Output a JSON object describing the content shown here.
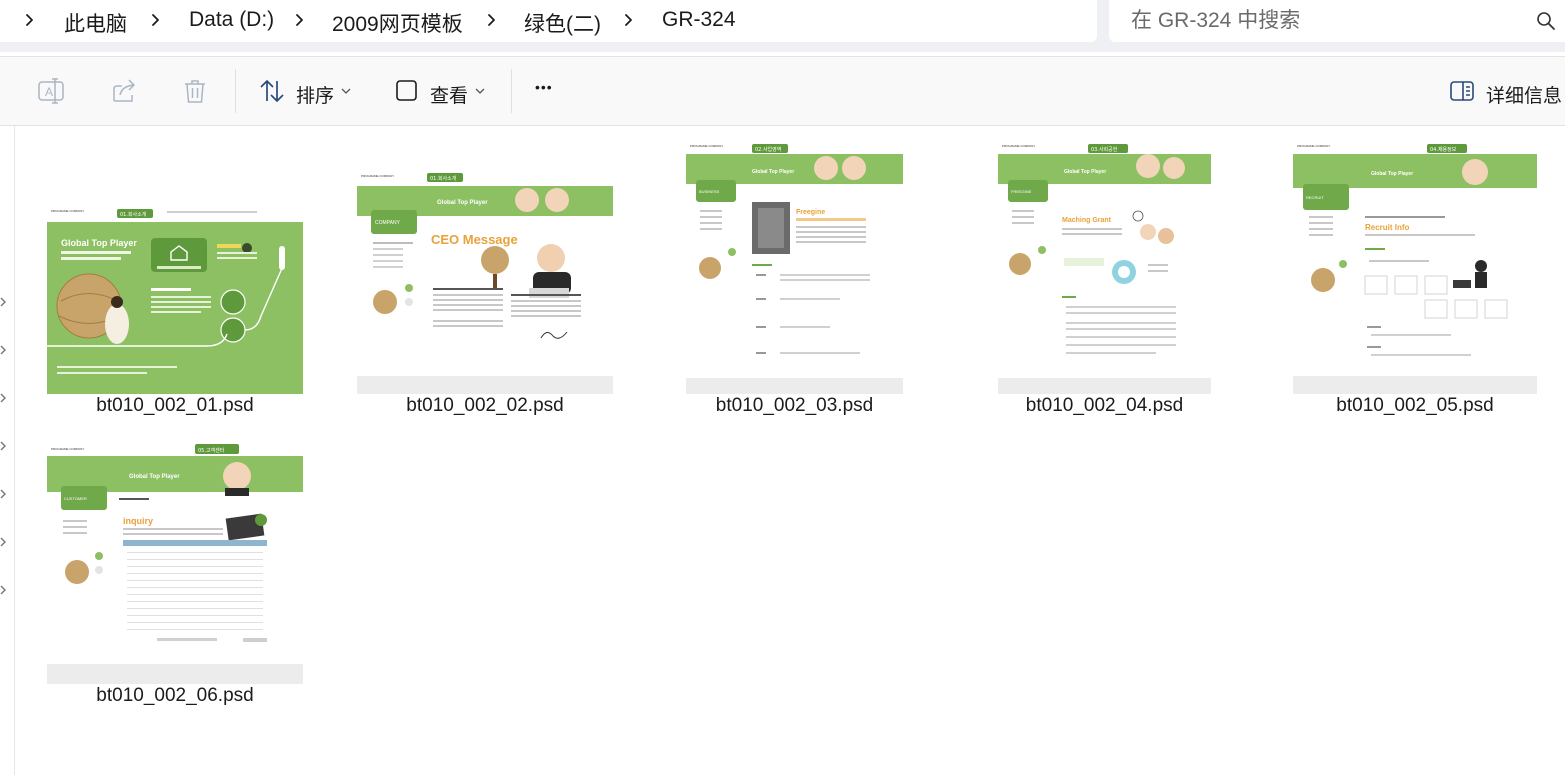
{
  "address_bar": {
    "path": [
      "此电脑",
      "Data (D:)",
      "2009网页模板",
      "绿色(二)",
      "GR-324"
    ]
  },
  "search": {
    "placeholder": "在 GR-324 中搜索"
  },
  "toolbar": {
    "sort_label": "排序",
    "view_label": "查看",
    "more_label": "•••",
    "details_label": "详细信息"
  },
  "files": [
    {
      "name": "bt010_002_01.psd",
      "thumb": {
        "heading": "Global Top Player",
        "section": "01.회사소개",
        "variant": "main"
      }
    },
    {
      "name": "bt010_002_02.psd",
      "thumb": {
        "heading": "Global Top Player",
        "section": "01.회사소개",
        "side_title": "COMPANY",
        "headline": "CEO Message",
        "variant": "ceo"
      }
    },
    {
      "name": "bt010_002_03.psd",
      "thumb": {
        "heading": "Global Top Player",
        "section": "02.사업영역",
        "side_title": "BUSINESS",
        "headline": "Freegine",
        "variant": "business"
      }
    },
    {
      "name": "bt010_002_04.psd",
      "thumb": {
        "heading": "Global Top Player",
        "section": "03.사회공헌",
        "side_title": "FREEGINE",
        "headline": "Maching Grant",
        "variant": "social"
      }
    },
    {
      "name": "bt010_002_05.psd",
      "thumb": {
        "heading": "Global Top Player",
        "section": "04.채용정보",
        "side_title": "RECRUIT",
        "headline": "Recruit Info",
        "variant": "recruit"
      }
    },
    {
      "name": "bt010_002_06.psd",
      "thumb": {
        "heading": "Global Top Player",
        "section": "05.고객센터",
        "side_title": "CUSTOMER",
        "headline": "inquiry",
        "variant": "inquiry"
      }
    }
  ],
  "colors": {
    "accent_green": "#8cc063",
    "dark_green": "#5e9a3b",
    "headline_orange": "#e8a23a",
    "text": "#1b1b1b",
    "toolbar_bg": "#f9f9f9",
    "addressbar_bg": "#eef0f3"
  },
  "icons": {
    "rename": "rename-icon",
    "share": "share-icon",
    "delete": "trash-icon",
    "sort": "sort-arrows-icon",
    "view": "view-square-icon",
    "details": "details-pane-icon",
    "search": "search-icon",
    "breadcrumb_separator": "chevron-right-icon"
  }
}
